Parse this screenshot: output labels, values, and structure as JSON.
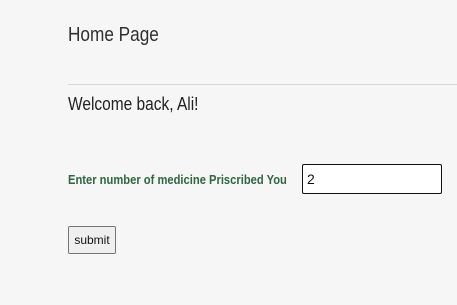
{
  "header": {
    "title": "Home Page"
  },
  "greeting": {
    "text": "Welcome back, Ali!"
  },
  "medicine_form": {
    "label": "Enter number of medicine Priscribed You",
    "input_value": "2",
    "submit_label": "submit"
  }
}
